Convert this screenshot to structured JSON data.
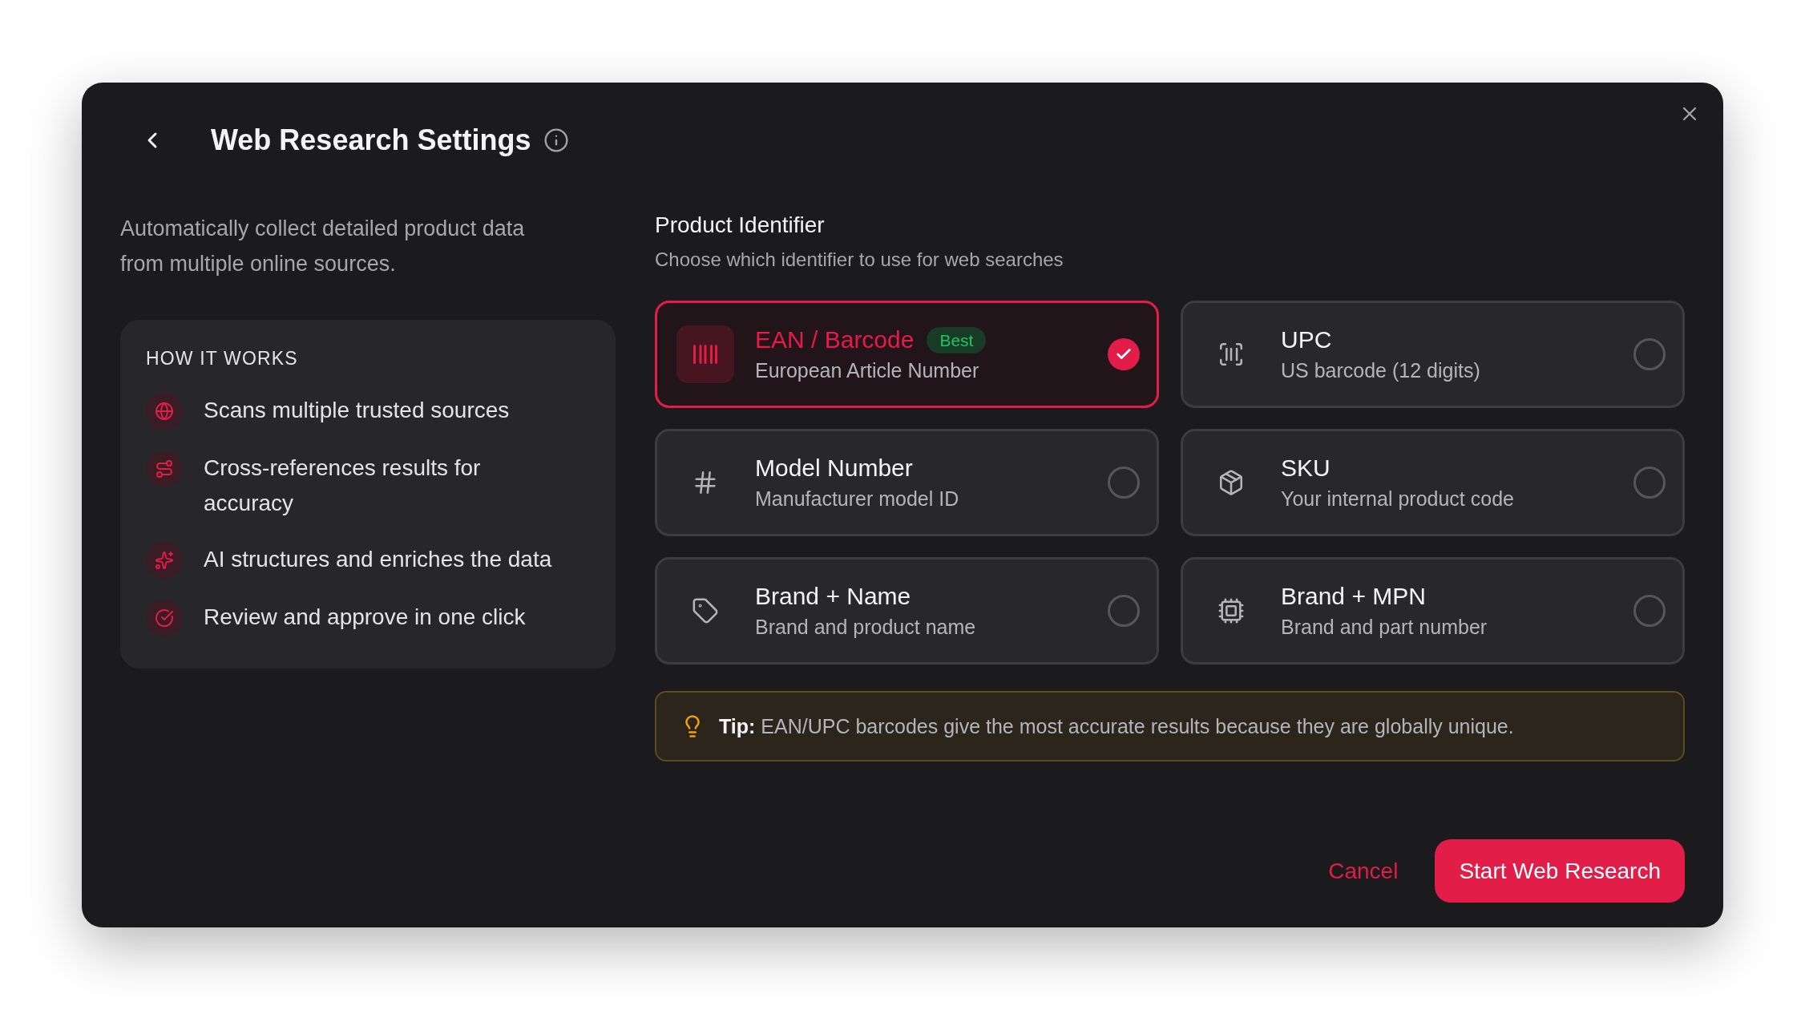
{
  "dialog": {
    "title": "Web Research Settings",
    "intro": "Automatically collect detailed product data from multiple online sources.",
    "how_it_works": {
      "heading": "HOW IT WORKS",
      "steps": [
        "Scans multiple trusted sources",
        "Cross-references results for accuracy",
        "AI structures and enriches the data",
        "Review and approve in one click"
      ]
    },
    "product_identifier": {
      "title": "Product Identifier",
      "subtitle": "Choose which identifier to use for web searches",
      "options": [
        {
          "label": "EAN / Barcode",
          "description": "European Article Number",
          "badge": "Best",
          "selected": true
        },
        {
          "label": "UPC",
          "description": "US barcode (12 digits)",
          "selected": false
        },
        {
          "label": "Model Number",
          "description": "Manufacturer model ID",
          "selected": false
        },
        {
          "label": "SKU",
          "description": "Your internal product code",
          "selected": false
        },
        {
          "label": "Brand + Name",
          "description": "Brand and product name",
          "selected": false
        },
        {
          "label": "Brand + MPN",
          "description": "Brand and part number",
          "selected": false
        }
      ],
      "tip": "**Tip:** EAN/UPC barcodes give the most accurate results because they are globally unique."
    },
    "buttons": [
      {
        "label": "Cancel",
        "kind": "text"
      },
      {
        "label": "Start Web Research",
        "kind": "primary"
      }
    ]
  }
}
